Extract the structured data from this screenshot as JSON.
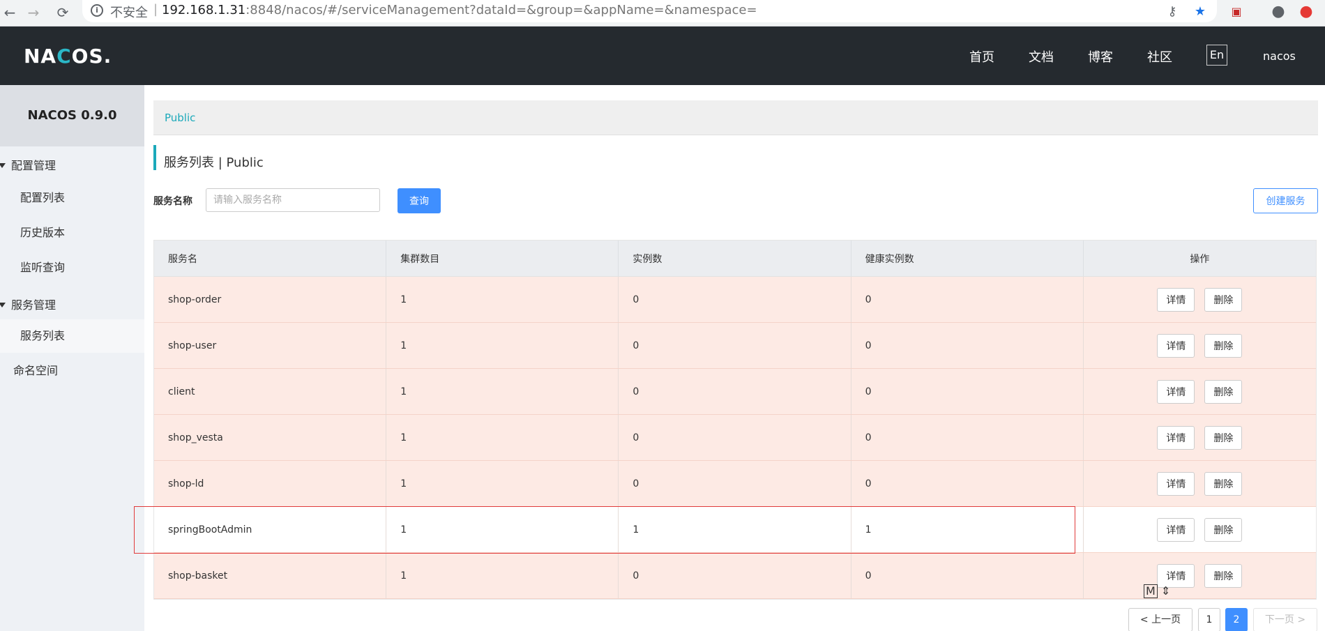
{
  "browser": {
    "back": "←",
    "forward": "→",
    "reload": "⟳",
    "info": "i",
    "insecure_label": "不安全",
    "separator": "|",
    "url_host": "192.168.1.31",
    "url_rest": ":8848/nacos/#/serviceManagement?dataId=&group=&appName=&namespace="
  },
  "header": {
    "logo_prefix": "NA",
    "logo_accent": "C",
    "logo_suffix": "OS.",
    "nav": [
      "首页",
      "文档",
      "博客",
      "社区"
    ],
    "lang": "En",
    "user": "nacos"
  },
  "sidebar": {
    "title": "NACOS 0.9.0",
    "config_group": "配置管理",
    "config_items": [
      "配置列表",
      "历史版本",
      "监听查询"
    ],
    "service_group": "服务管理",
    "service_items": [
      "服务列表"
    ],
    "namespace": "命名空间"
  },
  "main": {
    "breadcrumb": "Public",
    "title": "服务列表  |  Public",
    "search_label": "服务名称",
    "search_placeholder": "请输入服务名称",
    "query_button": "查询",
    "create_button": "创建服务"
  },
  "table": {
    "headers": [
      "服务名",
      "集群数目",
      "实例数",
      "健康实例数",
      "操作"
    ],
    "rows": [
      {
        "name": "shop-order",
        "clusters": "1",
        "instances": "0",
        "healthy": "0"
      },
      {
        "name": "shop-user",
        "clusters": "1",
        "instances": "0",
        "healthy": "0"
      },
      {
        "name": "client",
        "clusters": "1",
        "instances": "0",
        "healthy": "0"
      },
      {
        "name": "shop_vesta",
        "clusters": "1",
        "instances": "0",
        "healthy": "0"
      },
      {
        "name": "shop-ld",
        "clusters": "1",
        "instances": "0",
        "healthy": "0"
      },
      {
        "name": "springBootAdmin",
        "clusters": "1",
        "instances": "1",
        "healthy": "1"
      },
      {
        "name": "shop-basket",
        "clusters": "1",
        "instances": "0",
        "healthy": "0"
      }
    ],
    "detail_label": "详情",
    "delete_label": "删除"
  },
  "pagination": {
    "prev": "< 上一页",
    "pages": [
      "1",
      "2"
    ],
    "current_page": "2",
    "next": "下一页 >"
  },
  "mini_toolbar": "M",
  "colors": {
    "header_bg": "#252a2f",
    "accent": "#1ba9ba",
    "primary": "#3f8fff",
    "row_bg": "#fdeae4",
    "highlight": "#e03a3a"
  }
}
